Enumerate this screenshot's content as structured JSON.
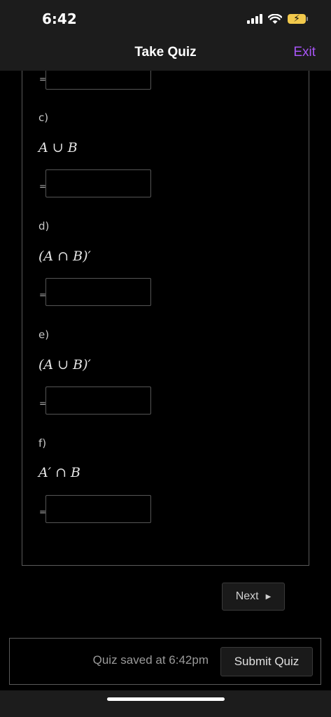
{
  "status_bar": {
    "time": "6:42",
    "icons": [
      "cellular-signal-icon",
      "wifi-icon",
      "battery-charging-icon"
    ]
  },
  "nav": {
    "title": "Take Quiz",
    "exit_label": "Exit",
    "exit_color": "#a855f7"
  },
  "quiz": {
    "parts": [
      {
        "label": "c)",
        "expression": "A ∪ B",
        "equals": "=",
        "answer": ""
      },
      {
        "label": "d)",
        "expression": "(A ∩ B)′",
        "equals": "=",
        "answer": ""
      },
      {
        "label": "e)",
        "expression": "(A ∪ B)′",
        "equals": "=",
        "answer": ""
      },
      {
        "label": "f)",
        "expression": "A′ ∩ B",
        "equals": "=",
        "answer": ""
      }
    ],
    "previous_equals": "="
  },
  "navigation": {
    "next_label": "Next"
  },
  "footer": {
    "save_status": "Quiz saved at 6:42pm",
    "submit_label": "Submit Quiz"
  }
}
